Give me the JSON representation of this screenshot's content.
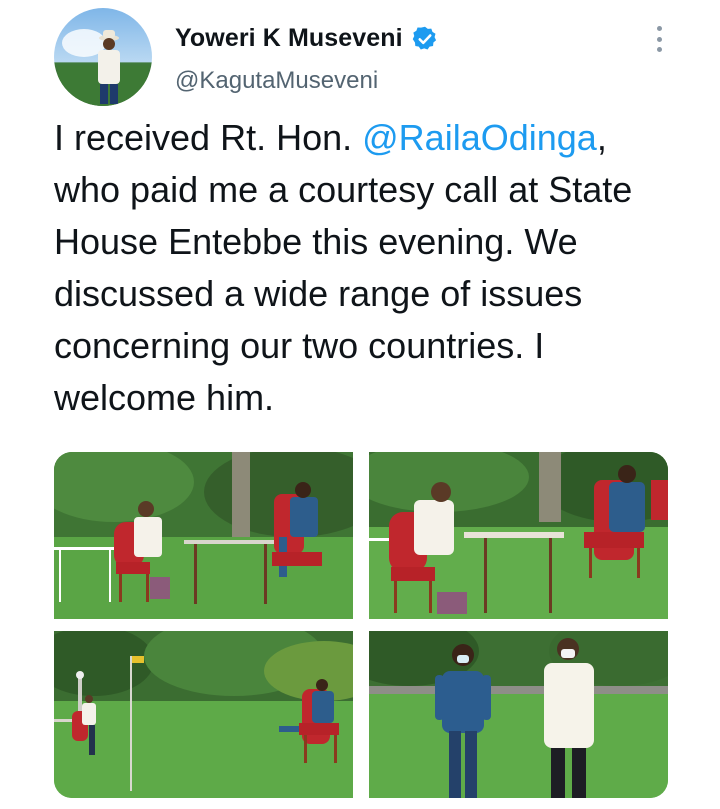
{
  "author": {
    "name": "Yoweri K Museveni",
    "handle": "@KagutaMuseveni",
    "verified_icon": "verified-badge-icon",
    "verified_color": "#1d9bf0"
  },
  "menu": {
    "icon": "more-options-icon"
  },
  "tweet": {
    "line1_before": "I received Rt. Hon. ",
    "mention": "@RailaOdinga",
    "line1_after": ",",
    "rest": "who paid me a courtesy call at State House Entebbe this evening. We discussed a wide range of issues concerning our two countries. I welcome him."
  },
  "media": {
    "count": 4,
    "photos": [
      "photo-meeting-wide",
      "photo-meeting-closeup",
      "photo-garden-flagpole",
      "photo-standing-masks"
    ]
  },
  "colors": {
    "text": "#0f1419",
    "secondary": "#536471",
    "link": "#1d9bf0",
    "grass": "#4f9a3a",
    "chair_red": "#c0272d"
  }
}
